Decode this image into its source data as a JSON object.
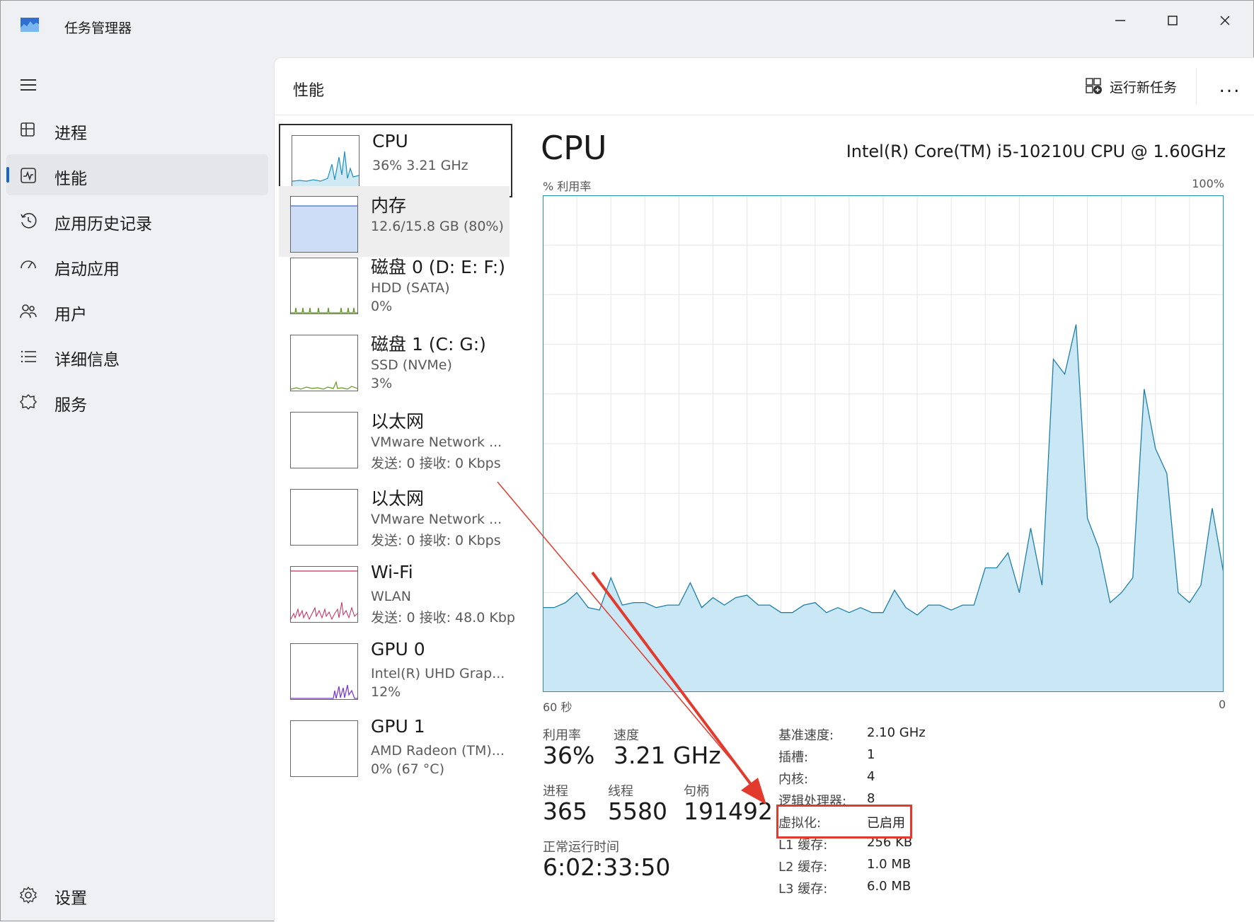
{
  "window": {
    "title": "任务管理器"
  },
  "nav": {
    "items": [
      {
        "label": "进程",
        "icon": "processes-icon"
      },
      {
        "label": "性能",
        "icon": "performance-icon",
        "active": true
      },
      {
        "label": "应用历史记录",
        "icon": "history-icon"
      },
      {
        "label": "启动应用",
        "icon": "startup-icon"
      },
      {
        "label": "用户",
        "icon": "users-icon"
      },
      {
        "label": "详细信息",
        "icon": "details-icon"
      },
      {
        "label": "服务",
        "icon": "services-icon"
      }
    ],
    "settings_label": "设置"
  },
  "header": {
    "title": "性能",
    "run_task": "运行新任务",
    "more": "..."
  },
  "resources": [
    {
      "name": "CPU",
      "line1": "36%  3.21 GHz",
      "line2": "",
      "color": "#1f8fbf"
    },
    {
      "name": "内存",
      "line1": "12.6/15.8 GB (80%)",
      "line2": "",
      "color": "#5b82d6"
    },
    {
      "name": "磁盘 0 (D: E: F:)",
      "line1": "HDD (SATA)",
      "line2": "0%",
      "color": "#5d9a1e"
    },
    {
      "name": "磁盘 1 (C: G:)",
      "line1": "SSD (NVMe)",
      "line2": "3%",
      "color": "#5d9a1e"
    },
    {
      "name": "以太网",
      "line1": "VMware Network ...",
      "line2": "发送: 0 接收: 0 Kbps",
      "color": "#a05a12"
    },
    {
      "name": "以太网",
      "line1": "VMware Network ...",
      "line2": "发送: 0 接收: 0 Kbps",
      "color": "#a05a12"
    },
    {
      "name": "Wi-Fi",
      "line1": "WLAN",
      "line2": "发送: 0 接收: 48.0 Kbp",
      "color": "#c22a5a"
    },
    {
      "name": "GPU 0",
      "line1": "Intel(R) UHD Grap...",
      "line2": "12%",
      "color": "#7a3fc8"
    },
    {
      "name": "GPU 1",
      "line1": "AMD Radeon (TM)...",
      "line2": "0% (67 °C)",
      "color": "#7a3fc8"
    }
  ],
  "detail": {
    "title": "CPU",
    "model": "Intel(R) Core(TM) i5-10210U CPU @ 1.60GHz",
    "y_label": "% 利用率",
    "y_max_label": "100%",
    "x_left_label": "60 秒",
    "x_right_label": "0",
    "stats": {
      "util_label": "利用率",
      "util_val": "36%",
      "speed_label": "速度",
      "speed_val": "3.21 GHz",
      "proc_label": "进程",
      "proc_val": "365",
      "thread_label": "线程",
      "thread_val": "5580",
      "handle_label": "句柄",
      "handle_val": "191492",
      "uptime_label": "正常运行时间",
      "uptime_val": "6:02:33:50"
    },
    "specs": [
      {
        "label": "基准速度:",
        "value": "2.10 GHz"
      },
      {
        "label": "插槽:",
        "value": "1"
      },
      {
        "label": "内核:",
        "value": "4"
      },
      {
        "label": "逻辑处理器:",
        "value": "8"
      },
      {
        "label": "虚拟化:",
        "value": "已启用"
      },
      {
        "label": "L1 缓存:",
        "value": "256 KB"
      },
      {
        "label": "L2 缓存:",
        "value": "1.0 MB"
      },
      {
        "label": "L3 缓存:",
        "value": "6.0 MB"
      }
    ]
  },
  "chart_data": {
    "type": "area",
    "ylim": [
      0,
      100
    ],
    "xlim": [
      60,
      0
    ],
    "grid": true,
    "values": [
      17,
      17,
      18,
      20,
      17,
      16.5,
      23,
      17.5,
      18,
      18,
      17,
      17.5,
      17.5,
      22,
      17,
      19,
      17.5,
      19,
      19.5,
      17.5,
      17.5,
      16,
      16,
      17.5,
      18,
      16,
      17,
      16,
      17,
      16,
      16,
      20.5,
      17,
      15.5,
      17.5,
      17.5,
      16.5,
      17.5,
      17.5,
      25,
      25,
      28,
      20,
      33,
      21.5,
      67,
      64,
      74,
      35,
      29,
      18,
      20,
      23,
      61,
      49,
      44,
      20,
      18,
      21.5,
      37,
      24
    ]
  },
  "annotation": {
    "color": "#e23b2e"
  }
}
